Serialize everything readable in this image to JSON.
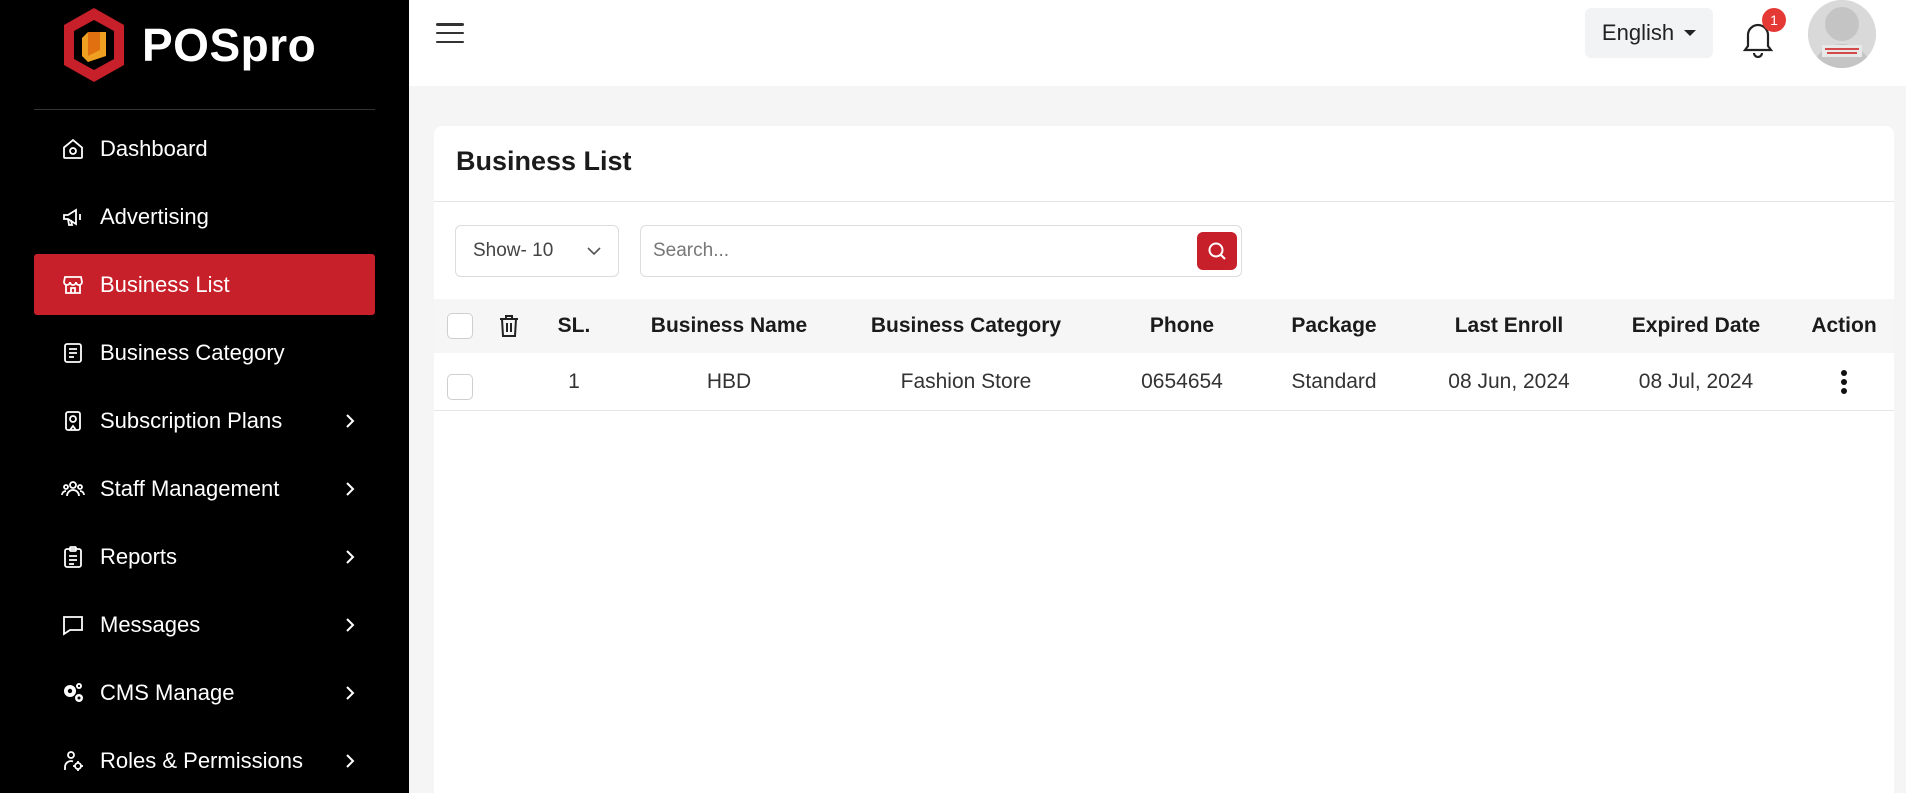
{
  "brand": {
    "name": "POSpro",
    "accent": "#c8202a"
  },
  "sidebar": {
    "items": [
      {
        "label": "Dashboard",
        "icon": "home-icon",
        "active": false,
        "has_submenu": false
      },
      {
        "label": "Advertising",
        "icon": "megaphone-icon",
        "active": false,
        "has_submenu": false
      },
      {
        "label": "Business List",
        "icon": "store-icon",
        "active": true,
        "has_submenu": false
      },
      {
        "label": "Business Category",
        "icon": "category-icon",
        "active": false,
        "has_submenu": false
      },
      {
        "label": "Subscription Plans",
        "icon": "subscription-icon",
        "active": false,
        "has_submenu": true
      },
      {
        "label": "Staff Management",
        "icon": "users-icon",
        "active": false,
        "has_submenu": true
      },
      {
        "label": "Reports",
        "icon": "clipboard-icon",
        "active": false,
        "has_submenu": true
      },
      {
        "label": "Messages",
        "icon": "message-icon",
        "active": false,
        "has_submenu": true
      },
      {
        "label": "CMS Manage",
        "icon": "gears-icon",
        "active": false,
        "has_submenu": true
      },
      {
        "label": "Roles & Permissions",
        "icon": "roles-icon",
        "active": false,
        "has_submenu": true
      }
    ]
  },
  "topbar": {
    "language": "English",
    "notification_count": "1"
  },
  "main": {
    "title": "Business List",
    "show_select": "Show- 10",
    "search_placeholder": "Search...",
    "table": {
      "headers": {
        "sl": "SL.",
        "business_name": "Business Name",
        "business_category": "Business Category",
        "phone": "Phone",
        "package": "Package",
        "last_enroll": "Last Enroll",
        "expired_date": "Expired Date",
        "action": "Action"
      },
      "rows": [
        {
          "sl": "1",
          "business_name": "HBD",
          "business_category": "Fashion Store",
          "phone": "0654654",
          "package": "Standard",
          "last_enroll": "08 Jun, 2024",
          "expired_date": "08 Jul, 2024"
        }
      ]
    }
  }
}
